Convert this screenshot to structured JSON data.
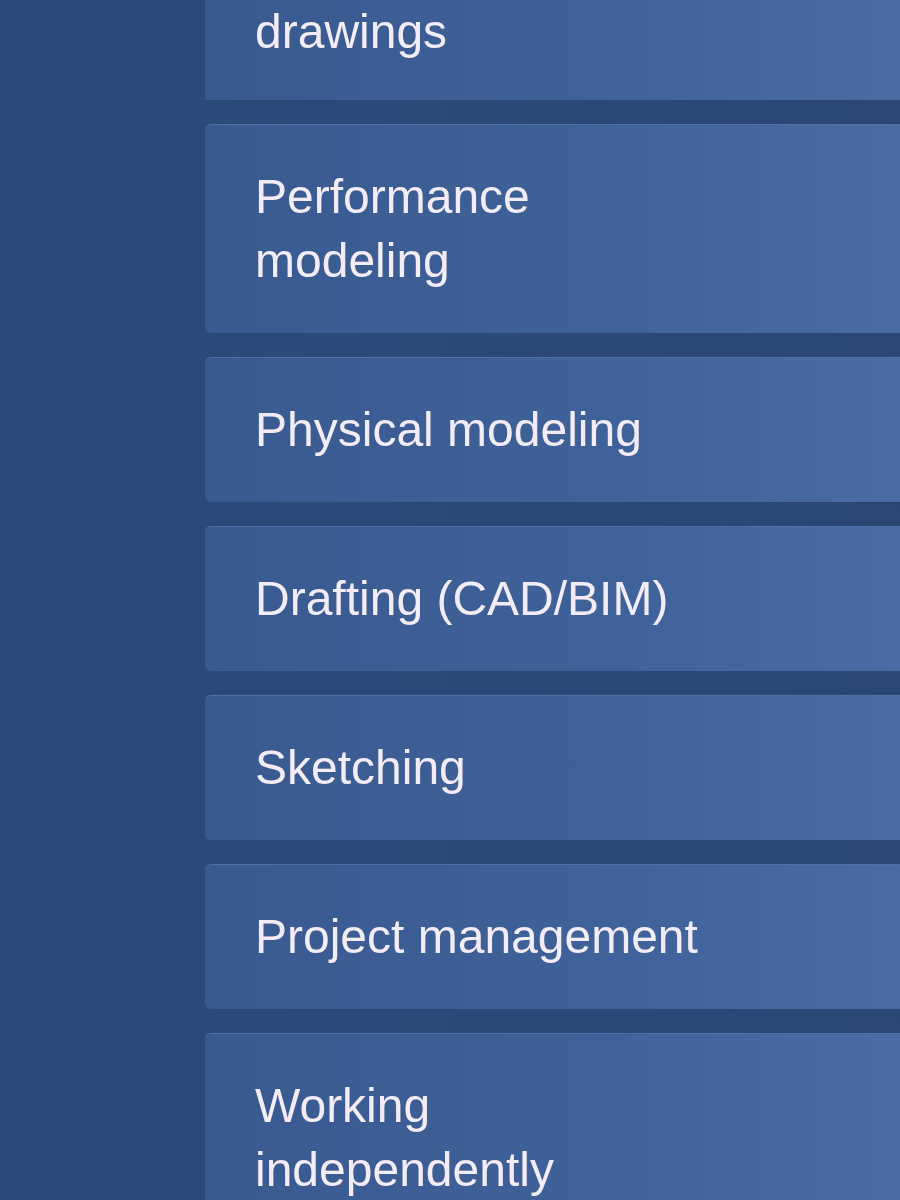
{
  "options": [
    {
      "label": "drawings"
    },
    {
      "label": "Performance modeling"
    },
    {
      "label": "Physical modeling"
    },
    {
      "label": "Drafting (CAD/BIM)"
    },
    {
      "label": "Sketching"
    },
    {
      "label": "Project management"
    },
    {
      "label": "Working independently"
    }
  ]
}
